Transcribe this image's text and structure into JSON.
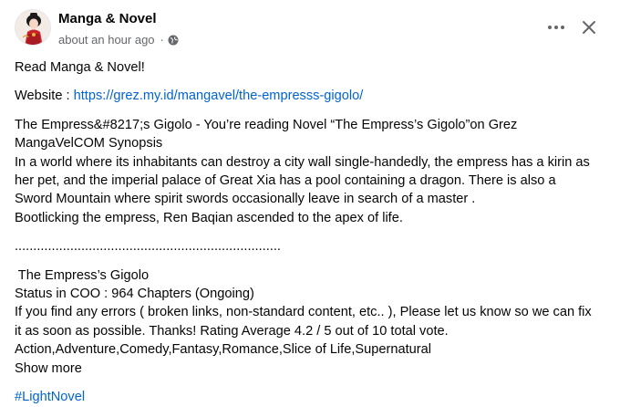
{
  "post": {
    "author": "Manga & Novel",
    "timestamp": "about an hour ago",
    "separator": "·",
    "audience_icon": "globe-icon",
    "more_icon": "more-options-icon",
    "close_icon": "close-icon"
  },
  "content": {
    "intro": "Read Manga & Novel!",
    "website_label": "Website : ",
    "website_url": "https://grez.my.id/mangavel/the-empresss-gigolo/",
    "synopsis_line1": "The Empress&#8217;s Gigolo - You’re reading Novel “The Empress’s Gigolo”on Grez",
    "synopsis_line2": "MangaVelCOM Synopsis",
    "synopsis_line3": "In a world where its inhabitants can destroy a city wall single-handedly, the empress has a kirin as",
    "synopsis_line4": "her pet, and the imperial palace of Great Xia has a pool containing a dragon. There is also a",
    "synopsis_line5": "Sword Mountain where spirit swords occasionally leave in search of a master .",
    "synopsis_line6": "Bootlicking the empress, Ren Baqian ascended to the apex of life.",
    "divider": "........................................................................",
    "title": " The Empress’s Gigolo",
    "status": "Status in COO : 964 Chapters (Ongoing)",
    "errors_line1": "If you find any errors ( broken links, non-standard content, etc.. ), Please let us know so we can fix",
    "errors_line2": "it as soon as possible. Thanks! Rating Average 4.2 / 5 out of 10 total vote.",
    "genres": "Action,Adventure,Comedy,Fantasy,Romance,Slice of Life,Supernatural",
    "show_more": "Show more",
    "hashtag": "#LightNovel"
  },
  "colors": {
    "text": "#050505",
    "secondary": "#65676b",
    "link": "#0064d1",
    "background": "#ffffff"
  }
}
